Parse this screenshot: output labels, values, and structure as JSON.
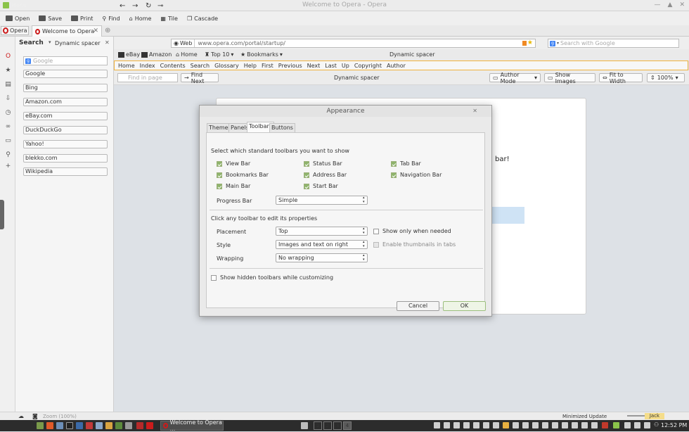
{
  "window": {
    "title": "Welcome to Opera - Opera"
  },
  "main_toolbar": {
    "items": [
      "Open",
      "Save",
      "Print",
      "Find",
      "Home",
      "Tile",
      "Cascade"
    ]
  },
  "tabs": {
    "menu_label": "Opera",
    "active_tab": "Welcome to Opera"
  },
  "panel": {
    "title": "Search",
    "spacer": "Dynamic spacer",
    "search_placeholder": "Google",
    "engines": [
      "Google",
      "Bing",
      "Amazon.com",
      "eBay.com",
      "DuckDuckGo",
      "Yahoo!",
      "blekko.com",
      "Wikipedia"
    ]
  },
  "address": {
    "scheme_label": "Web",
    "url": "www.opera.com/portal/startup/",
    "search_placeholder": "Search with Google"
  },
  "bookmarks_bar": {
    "items": [
      "eBay",
      "Amazon",
      "Home",
      "Top 10",
      "Bookmarks"
    ],
    "spacer": "Dynamic spacer"
  },
  "navigation_bar": {
    "items": [
      "Home",
      "Index",
      "Contents",
      "Search",
      "Glossary",
      "Help",
      "First",
      "Previous",
      "Next",
      "Last",
      "Up",
      "Copyright",
      "Author"
    ]
  },
  "find_bar": {
    "placeholder": "Find in page",
    "find_next": "Find Next",
    "spacer": "Dynamic spacer",
    "author_mode": "Author Mode",
    "show_images": "Show Images",
    "fit_to_width": "Fit to Width",
    "zoom": "100%"
  },
  "page": {
    "partial_text": "bar!"
  },
  "dialog": {
    "title": "Appearance",
    "tabs": [
      "Themes",
      "Panels",
      "Toolbars",
      "Buttons"
    ],
    "active_tab": "Toolbars",
    "intro": "Select which standard toolbars you want to show",
    "toolbars": [
      {
        "label": "View Bar",
        "checked": true
      },
      {
        "label": "Status Bar",
        "checked": true
      },
      {
        "label": "Tab Bar",
        "checked": true
      },
      {
        "label": "Bookmarks Bar",
        "checked": true
      },
      {
        "label": "Address Bar",
        "checked": true
      },
      {
        "label": "Navigation Bar",
        "checked": true
      },
      {
        "label": "Main Bar",
        "checked": true
      },
      {
        "label": "Start Bar",
        "checked": true
      }
    ],
    "progress_bar_label": "Progress Bar",
    "progress_bar_value": "Simple",
    "click_intro": "Click any toolbar to edit its properties",
    "placement_label": "Placement",
    "placement_value": "Top",
    "show_only_needed": "Show only when needed",
    "style_label": "Style",
    "style_value": "Images and text on right",
    "enable_thumbnails": "Enable thumbnails in tabs",
    "wrapping_label": "Wrapping",
    "wrapping_value": "No wrapping",
    "show_hidden": "Show hidden toolbars while customizing",
    "cancel": "Cancel",
    "ok": "OK"
  },
  "status_bar": {
    "zoom": "Zoom (100%)",
    "update": "Minimized Update",
    "user": "Jack"
  },
  "taskbar": {
    "menu": "Menu",
    "task": "Welcome to Opera ...",
    "workspaces": [
      "1",
      "2",
      "3",
      "4"
    ],
    "active_workspace": "4",
    "clock": "12:52 PM"
  }
}
